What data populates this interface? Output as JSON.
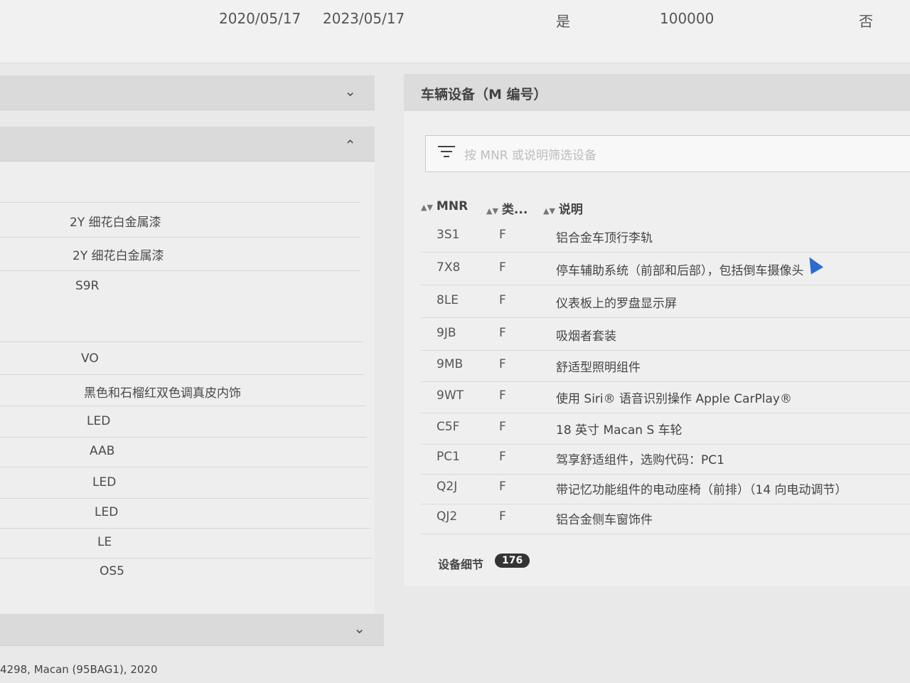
{
  "top_row": {
    "date_start": "2020/05/17",
    "date_end": "2023/05/17",
    "flag": "是",
    "mileage": "100000",
    "flag2": "否"
  },
  "left_panel": {
    "items": [
      {
        "label": "2Y 细花白金属漆"
      },
      {
        "label": "2Y 细花白金属漆"
      },
      {
        "label": "S9R"
      },
      {
        "label": "VO"
      },
      {
        "label": "黑色和石榴红双色调真皮内饰"
      },
      {
        "label": "LED"
      },
      {
        "label": "AAB"
      },
      {
        "label": "LED"
      },
      {
        "label": "LED"
      },
      {
        "label": "LE"
      },
      {
        "label": "OS5"
      }
    ],
    "footer": "4298, Macan (95BAG1), 2020"
  },
  "right_panel": {
    "title": "车辆设备（M 编号）",
    "filter_placeholder": "按 MNR 或说明筛选设备",
    "columns": [
      "MNR",
      "类...",
      "说明"
    ],
    "rows": [
      {
        "mnr": "3S1",
        "type": "F",
        "desc": "铝合金车顶行李轨"
      },
      {
        "mnr": "7X8",
        "type": "F",
        "desc": "停车辅助系统（前部和后部），包括倒车摄像头"
      },
      {
        "mnr": "8LE",
        "type": "F",
        "desc": "仪表板上的罗盘显示屏"
      },
      {
        "mnr": "9JB",
        "type": "F",
        "desc": "吸烟者套装"
      },
      {
        "mnr": "9MB",
        "type": "F",
        "desc": "舒适型照明组件"
      },
      {
        "mnr": "9WT",
        "type": "F",
        "desc": "使用 Siri® 语音识别操作 Apple CarPlay®"
      },
      {
        "mnr": "C5F",
        "type": "F",
        "desc": "18 英寸 Macan S 车轮"
      },
      {
        "mnr": "PC1",
        "type": "F",
        "desc": "驾享舒适组件，选购代码：PC1"
      },
      {
        "mnr": "Q2J",
        "type": "F",
        "desc": "带记忆功能组件的电动座椅（前排）（14 向电动调节）"
      },
      {
        "mnr": "QJ2",
        "type": "F",
        "desc": "铝合金侧车窗饰件"
      }
    ],
    "details_label": "设备细节",
    "details_count": "176"
  },
  "icons": {
    "chevron_down": "chevron-down-icon",
    "chevron_up": "chevron-up-icon",
    "filter": "filter-icon",
    "sort": "sort-icon"
  }
}
